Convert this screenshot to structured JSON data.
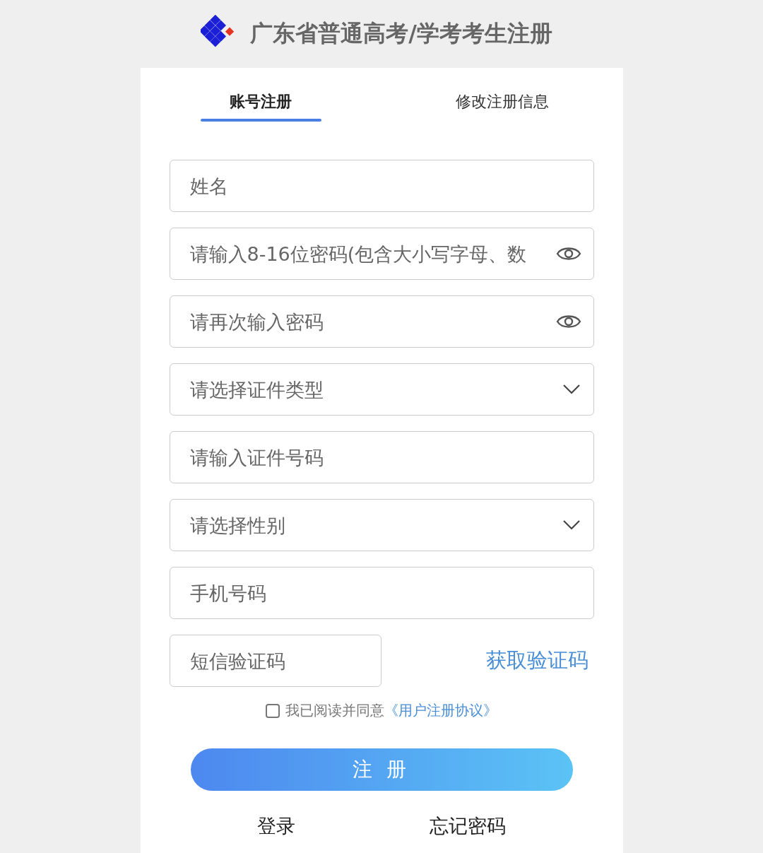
{
  "header": {
    "title": "广东省普通高考/学考考生注册"
  },
  "tabs": [
    {
      "label": "账号注册",
      "selected": true
    },
    {
      "label": "修改注册信息",
      "selected": false
    }
  ],
  "fields": [
    {
      "kind": "text",
      "placeholder": "姓名"
    },
    {
      "kind": "password",
      "placeholder": "请输入8-16位密码(包含大小写字母、数"
    },
    {
      "kind": "password",
      "placeholder": "请再次输入密码"
    },
    {
      "kind": "select",
      "placeholder": "请选择证件类型"
    },
    {
      "kind": "text",
      "placeholder": "请输入证件号码"
    },
    {
      "kind": "select",
      "placeholder": "请选择性别"
    },
    {
      "kind": "text",
      "placeholder": "手机号码"
    }
  ],
  "sms": {
    "placeholder": "短信验证码",
    "button": "获取验证码"
  },
  "agreement": {
    "checked": false,
    "text": "我已阅读并同意",
    "link": "《用户注册协议》"
  },
  "submit": "注 册",
  "links": [
    "登录",
    "忘记密码"
  ]
}
